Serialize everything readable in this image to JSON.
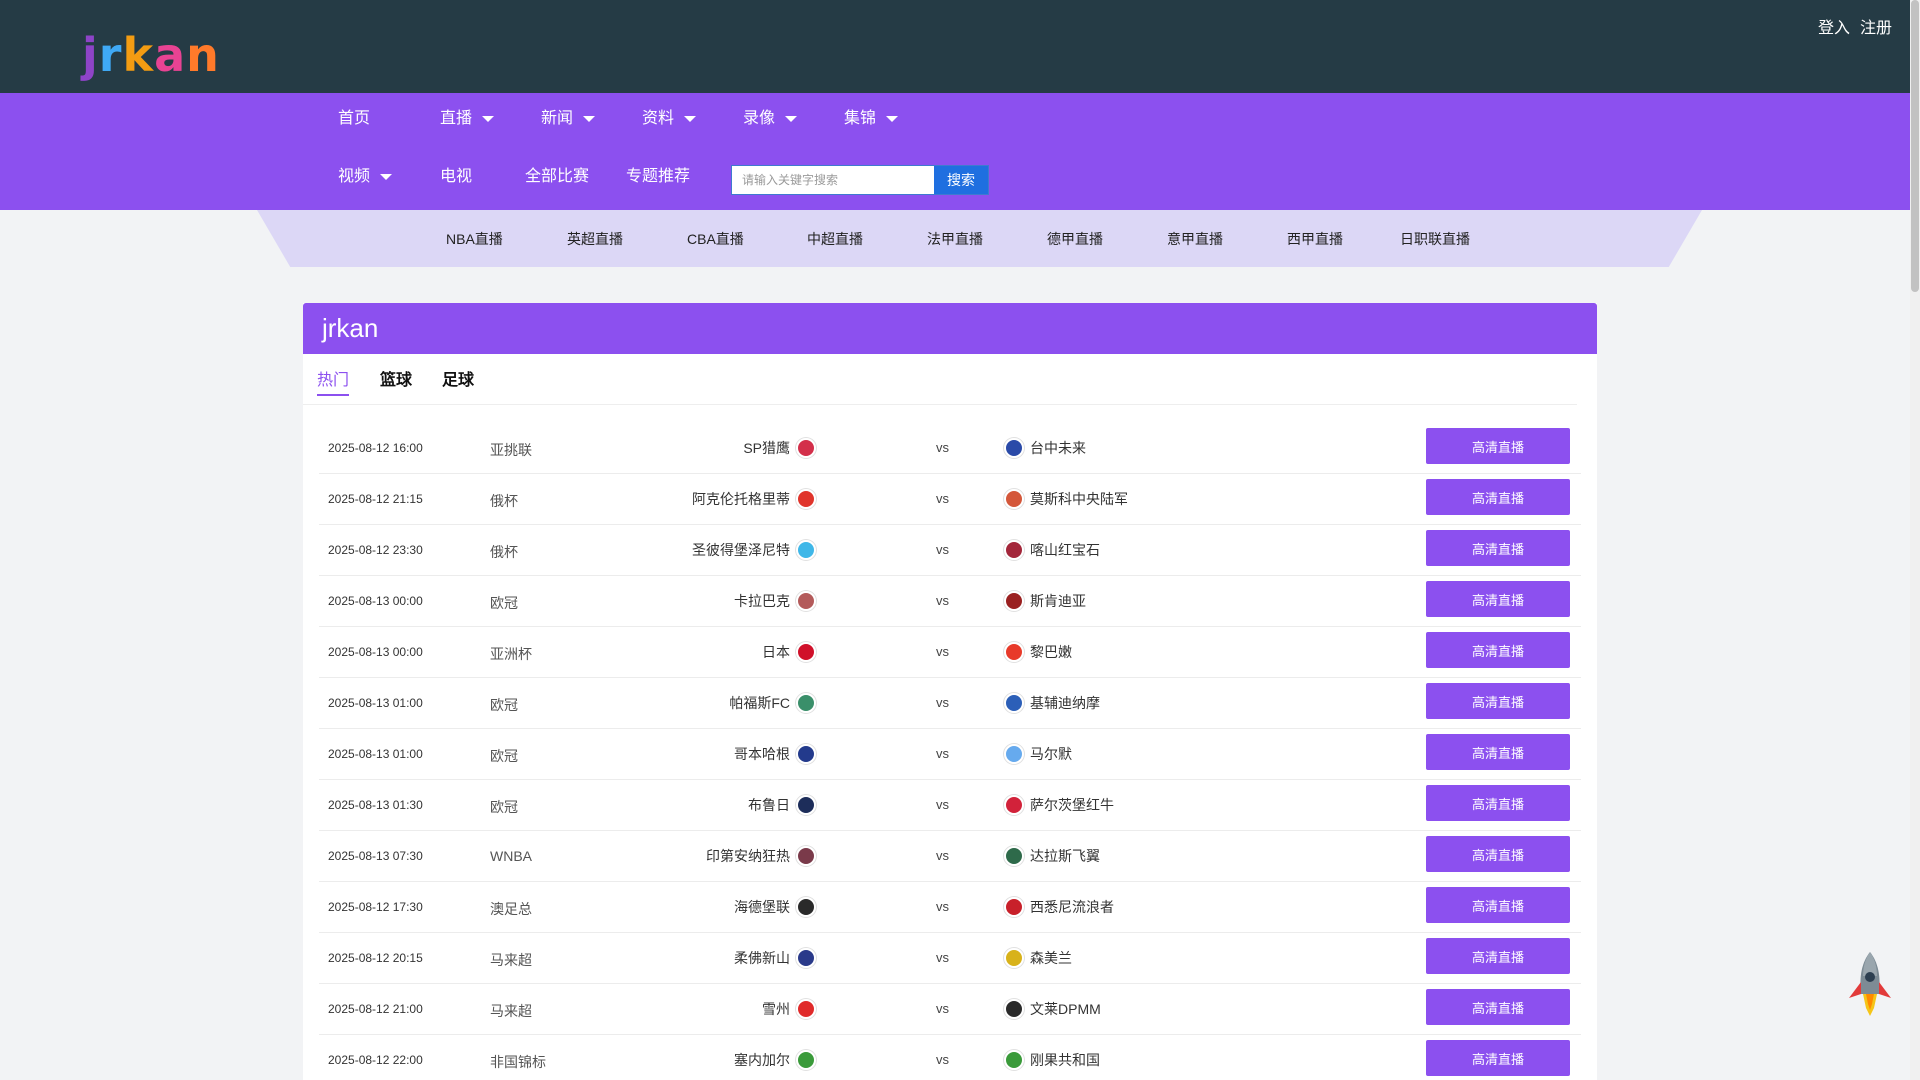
{
  "header": {
    "logo_text": "jrkan",
    "logo_letters": [
      {
        "char": "j",
        "color": "#8e44c8"
      },
      {
        "char": "r",
        "color": "#3fa9f5"
      },
      {
        "char": "k",
        "color": "#f39c12"
      },
      {
        "char": "a",
        "color": "#e84393"
      },
      {
        "char": "n",
        "color": "#ff7a2a"
      }
    ],
    "login": "登入",
    "register": "注册"
  },
  "nav": {
    "items": [
      {
        "label": "首页",
        "dropdown": false
      },
      {
        "label": "直播",
        "dropdown": true
      },
      {
        "label": "新闻",
        "dropdown": true
      },
      {
        "label": "资料",
        "dropdown": true
      },
      {
        "label": "录像",
        "dropdown": true
      },
      {
        "label": "集锦",
        "dropdown": true
      },
      {
        "label": "视频",
        "dropdown": true
      },
      {
        "label": "电视",
        "dropdown": false
      },
      {
        "label": "全部比赛",
        "dropdown": false
      },
      {
        "label": "专题推荐",
        "dropdown": false
      }
    ],
    "search_placeholder": "请输入关键字搜索",
    "search_button": "搜索"
  },
  "subnav": {
    "items": [
      "NBA直播",
      "英超直播",
      "CBA直播",
      "中超直播",
      "法甲直播",
      "德甲直播",
      "意甲直播",
      "西甲直播",
      "日职联直播"
    ]
  },
  "main": {
    "title": "jrkan",
    "tabs": [
      "热门",
      "篮球",
      "足球"
    ],
    "active_tab": "热门",
    "vs_label": "vs",
    "button_label": "高清直播",
    "matches": [
      {
        "time": "2025-08-12 16:00",
        "league": "亚挑联",
        "home": "SP猎鹰",
        "away": "台中未来",
        "home_color": "#d32f4a",
        "away_color": "#2a4aa8"
      },
      {
        "time": "2025-08-12 21:15",
        "league": "俄杯",
        "home": "阿克伦托格里蒂",
        "away": "莫斯科中央陆军",
        "home_color": "#e0342b",
        "away_color": "#d4573a"
      },
      {
        "time": "2025-08-12 23:30",
        "league": "俄杯",
        "home": "圣彼得堡泽尼特",
        "away": "喀山红宝石",
        "home_color": "#3fb7e8",
        "away_color": "#a3263a"
      },
      {
        "time": "2025-08-13 00:00",
        "league": "欧冠",
        "home": "卡拉巴克",
        "away": "斯肯迪亚",
        "home_color": "#b35a5a",
        "away_color": "#9a2020"
      },
      {
        "time": "2025-08-13 00:00",
        "league": "亚洲杯",
        "home": "日本",
        "away": "黎巴嫩",
        "home_color": "#d0102a",
        "away_color": "#e83a2a"
      },
      {
        "time": "2025-08-13 01:00",
        "league": "欧冠",
        "home": "帕福斯FC",
        "away": "基辅迪纳摩",
        "home_color": "#3a8f6a",
        "away_color": "#2c5fb8"
      },
      {
        "time": "2025-08-13 01:00",
        "league": "欧冠",
        "home": "哥本哈根",
        "away": "马尔默",
        "home_color": "#233a8c",
        "away_color": "#66aaee"
      },
      {
        "time": "2025-08-13 01:30",
        "league": "欧冠",
        "home": "布鲁日",
        "away": "萨尔茨堡红牛",
        "home_color": "#1d2d5a",
        "away_color": "#d2223a"
      },
      {
        "time": "2025-08-13 07:30",
        "league": "WNBA",
        "home": "印第安纳狂热",
        "away": "达拉斯飞翼",
        "home_color": "#7a3a4a",
        "away_color": "#2e6a4a"
      },
      {
        "time": "2025-08-12 17:30",
        "league": "澳足总",
        "home": "海德堡联",
        "away": "西悉尼流浪者",
        "home_color": "#2a2a2a",
        "away_color": "#c8202a"
      },
      {
        "time": "2025-08-12 20:15",
        "league": "马来超",
        "home": "柔佛新山",
        "away": "森美兰",
        "home_color": "#2a3a8a",
        "away_color": "#d8b21a"
      },
      {
        "time": "2025-08-12 21:00",
        "league": "马来超",
        "home": "雪州",
        "away": "文莱DPMM",
        "home_color": "#e02a2a",
        "away_color": "#2a2a2a"
      },
      {
        "time": "2025-08-12 22:00",
        "league": "非国锦标",
        "home": "塞内加尔",
        "away": "刚果共和国",
        "home_color": "#3a9a3a",
        "away_color": "#3a9a3a"
      }
    ]
  },
  "colors": {
    "topbar": "#253b45",
    "accent": "#8c50ef",
    "subnav": "#dcd7f6",
    "search_button": "#1f6fe0"
  }
}
